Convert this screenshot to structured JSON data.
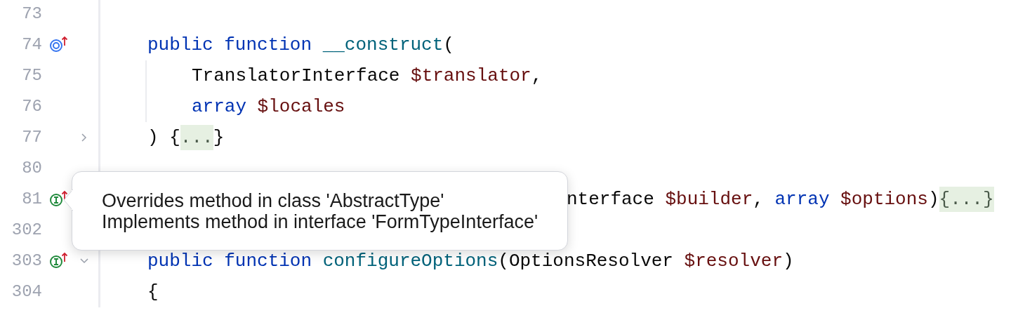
{
  "lines": [
    {
      "number": "73"
    },
    {
      "number": "74",
      "icon": {
        "kind": "implementing"
      },
      "tokens": [
        {
          "kind": "keyword",
          "text": "public"
        },
        {
          "kind": "keyword",
          "text": " function"
        },
        {
          "kind": "function",
          "text": " __construct"
        },
        {
          "kind": "plain",
          "text": "("
        }
      ],
      "children": [
        {
          "number": "75",
          "tokens": [
            {
              "kind": "plain",
              "text": "TranslatorInterface"
            },
            {
              "kind": "variable",
              "text": " $translator"
            },
            {
              "kind": "plain",
              "text": ","
            }
          ]
        },
        {
          "number": "76",
          "tokens": [
            {
              "kind": "keyword",
              "text": "array"
            },
            {
              "kind": "variable",
              "text": " $locales"
            }
          ]
        }
      ]
    },
    {
      "number": "77",
      "fold": {
        "expanded": false
      },
      "tokens": [
        {
          "kind": "plain",
          "text": ") {"
        },
        {
          "kind": "folded",
          "text": "..."
        },
        {
          "kind": "plain",
          "text": "}"
        }
      ]
    },
    {
      "number": "80"
    },
    {
      "number": "81",
      "icon": {
        "kind": "implemented"
      },
      "partial": true,
      "tokens": [
        {
          "kind": "plain",
          "text": "nterface"
        },
        {
          "kind": "variable",
          "text": " $builder"
        },
        {
          "kind": "plain",
          "text": ","
        },
        {
          "kind": "keyword",
          "text": " array"
        },
        {
          "kind": "variable",
          "text": " $options"
        },
        {
          "kind": "plain",
          "text": ")"
        },
        {
          "kind": "folded",
          "text": "{...}"
        }
      ]
    },
    {
      "number": "302"
    },
    {
      "number": "303",
      "icon": {
        "kind": "implemented"
      },
      "fold": {
        "expanded": true
      },
      "tokens": [
        {
          "kind": "keyword",
          "text": "public"
        },
        {
          "kind": "keyword",
          "text": " function"
        },
        {
          "kind": "function",
          "text": " configureOptions"
        },
        {
          "kind": "plain",
          "text": "(OptionsResolver"
        },
        {
          "kind": "variable",
          "text": " $resolver"
        },
        {
          "kind": "plain",
          "text": ")"
        }
      ]
    },
    {
      "number": "304",
      "tokens": [
        {
          "kind": "plain",
          "text": "{"
        }
      ]
    }
  ],
  "tooltip": {
    "lines": [
      "Overrides method in class 'AbstractType'",
      "Implements method in interface 'FormTypeInterface'"
    ]
  }
}
